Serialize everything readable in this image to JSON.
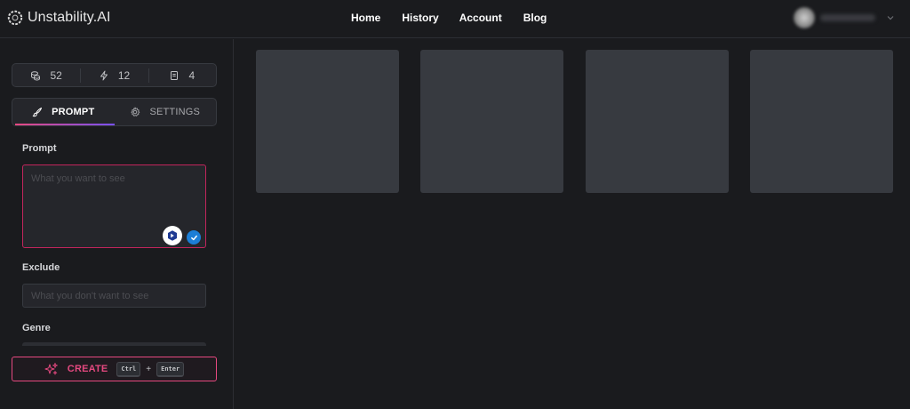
{
  "app": {
    "name": "Unstability.AI"
  },
  "nav": [
    {
      "label": "Home"
    },
    {
      "label": "History"
    },
    {
      "label": "Account"
    },
    {
      "label": "Blog"
    }
  ],
  "stats": {
    "credits": "52",
    "fast": "12",
    "docs": "4"
  },
  "tabs": {
    "prompt": "PROMPT",
    "settings": "SETTINGS"
  },
  "form": {
    "prompt_label": "Prompt",
    "prompt_placeholder": "What you want to see",
    "exclude_label": "Exclude",
    "exclude_placeholder": "What you don't want to see",
    "genre_label": "Genre"
  },
  "create": {
    "label": "CREATE",
    "key1": "Ctrl",
    "plus": "+",
    "key2": "Enter"
  },
  "colors": {
    "accent": "#e64980",
    "accent_secondary": "#7950f2",
    "check": "#1c7ed6"
  },
  "icons": [
    "logo-icon",
    "coins-icon",
    "bolt-icon",
    "document-icon",
    "brush-icon",
    "gear-icon",
    "enhance-icon",
    "check-icon",
    "sparkle-icon",
    "chevron-down-icon"
  ]
}
